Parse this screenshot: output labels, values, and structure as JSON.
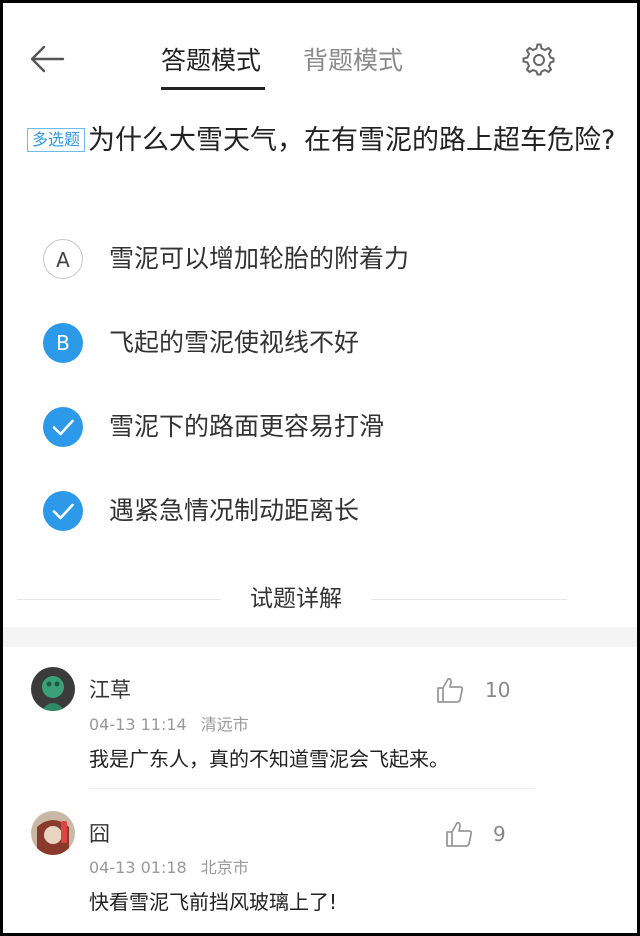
{
  "header": {
    "tabs": [
      {
        "label": "答题模式",
        "active": true
      },
      {
        "label": "背题模式",
        "active": false
      }
    ]
  },
  "question": {
    "type_label": "多选题",
    "text": "为什么大雪天气，在有雪泥的路上超车危险?"
  },
  "options": [
    {
      "marker": "A",
      "text": "雪泥可以增加轮胎的附着力",
      "state": "unselected"
    },
    {
      "marker": "B",
      "text": "飞起的雪泥使视线不好",
      "state": "selected"
    },
    {
      "marker": "check",
      "text": "雪泥下的路面更容易打滑",
      "state": "correct"
    },
    {
      "marker": "check",
      "text": "遇紧急情况制动距离长",
      "state": "correct"
    }
  ],
  "explanation_heading": "试题详解",
  "comments": [
    {
      "name": "江草",
      "likes": "10",
      "time": "04-13 11:14",
      "location": "清远市",
      "text": "我是广东人，真的不知道雪泥会飞起来。"
    },
    {
      "name": "囧",
      "likes": "9",
      "time": "04-13 01:18",
      "location": "北京市",
      "text": "快看雪泥飞前挡风玻璃上了!"
    }
  ],
  "colors": {
    "accent": "#2c9ae8",
    "text": "#222222",
    "muted": "#999999"
  }
}
